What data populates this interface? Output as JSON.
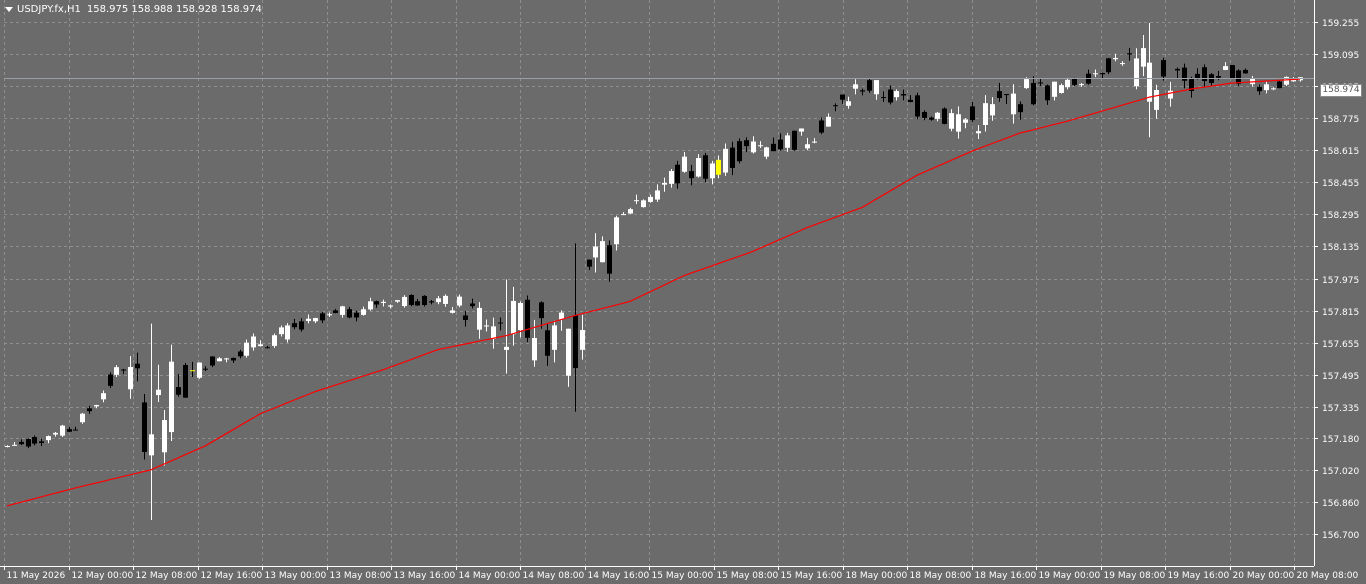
{
  "header": {
    "symbol_label": "USDJPY.fx,H1",
    "ohlc": "158.975 158.988 158.928 158.974"
  },
  "current_price_label": "158.974",
  "colors": {
    "background": "#6b6b6b",
    "grid": "#8f8f8f",
    "text": "#ffffff",
    "bull_candle": "#ffffff",
    "bear_candle": "#000000",
    "highlight_candle": "#ffff00",
    "moving_average": "#ff0000",
    "bid_line": "#9aa0a6"
  },
  "chart_data": {
    "type": "candlestick",
    "ylim": [
      156.7,
      159.33
    ],
    "y_ticks": [
      "159.255",
      "159.095",
      "158.935",
      "158.775",
      "158.615",
      "158.455",
      "158.295",
      "158.135",
      "157.975",
      "157.815",
      "157.655",
      "157.495",
      "157.335",
      "157.180",
      "157.020",
      "156.860",
      "156.700"
    ],
    "x_ticks": [
      "11 May 2026",
      "12 May 00:00",
      "12 May 08:00",
      "12 May 16:00",
      "13 May 00:00",
      "13 May 08:00",
      "13 May 16:00",
      "14 May 00:00",
      "14 May 08:00",
      "14 May 16:00",
      "15 May 00:00",
      "15 May 08:00",
      "15 May 16:00",
      "18 May 00:00",
      "18 May 08:00",
      "18 May 16:00",
      "19 May 00:00",
      "19 May 08:00",
      "19 May 16:00",
      "20 May 00:00",
      "20 May 08:00"
    ],
    "current_price": 158.974,
    "grid": true,
    "candle_anchors": [
      {
        "bar": 0,
        "low": 157.08,
        "high": 157.19
      },
      {
        "bar": 10,
        "low": 157.18,
        "high": 157.28
      },
      {
        "bar": 17,
        "low": 157.46,
        "high": 157.63
      },
      {
        "bar": 21,
        "low": 156.77,
        "high": 157.75
      },
      {
        "bar": 29,
        "low": 157.5,
        "high": 157.6
      },
      {
        "bar": 37,
        "low": 157.58,
        "high": 157.74
      },
      {
        "bar": 45,
        "low": 157.68,
        "high": 157.82
      },
      {
        "bar": 55,
        "low": 157.8,
        "high": 157.93
      },
      {
        "bar": 63,
        "low": 157.83,
        "high": 157.91
      },
      {
        "bar": 73,
        "low": 157.5,
        "high": 157.97
      },
      {
        "bar": 83,
        "low": 157.31,
        "high": 158.15
      },
      {
        "bar": 91,
        "low": 158.25,
        "high": 158.43
      },
      {
        "bar": 99,
        "low": 158.36,
        "high": 158.67
      },
      {
        "bar": 109,
        "low": 158.51,
        "high": 158.73
      },
      {
        "bar": 117,
        "low": 158.58,
        "high": 158.79
      },
      {
        "bar": 125,
        "low": 158.85,
        "high": 159.04
      },
      {
        "bar": 133,
        "low": 158.73,
        "high": 158.93
      },
      {
        "bar": 141,
        "low": 158.61,
        "high": 158.91
      },
      {
        "bar": 148,
        "low": 158.73,
        "high": 159.05
      },
      {
        "bar": 155,
        "low": 158.87,
        "high": 159.0
      },
      {
        "bar": 163,
        "low": 159.0,
        "high": 159.16
      },
      {
        "bar": 167,
        "low": 158.68,
        "high": 159.25
      },
      {
        "bar": 173,
        "low": 158.83,
        "high": 159.09
      },
      {
        "bar": 179,
        "low": 158.93,
        "high": 159.07
      },
      {
        "bar": 184,
        "low": 158.86,
        "high": 159.02
      },
      {
        "bar": 189,
        "low": 158.94,
        "high": 158.99
      }
    ],
    "ma_anchors": [
      {
        "bar": 0,
        "value": 156.84
      },
      {
        "bar": 10,
        "value": 156.93
      },
      {
        "bar": 21,
        "value": 157.02
      },
      {
        "bar": 29,
        "value": 157.14
      },
      {
        "bar": 37,
        "value": 157.3
      },
      {
        "bar": 45,
        "value": 157.41
      },
      {
        "bar": 55,
        "value": 157.52
      },
      {
        "bar": 63,
        "value": 157.62
      },
      {
        "bar": 73,
        "value": 157.69
      },
      {
        "bar": 83,
        "value": 157.79
      },
      {
        "bar": 91,
        "value": 157.86
      },
      {
        "bar": 99,
        "value": 157.99
      },
      {
        "bar": 109,
        "value": 158.11
      },
      {
        "bar": 117,
        "value": 158.23
      },
      {
        "bar": 125,
        "value": 158.33
      },
      {
        "bar": 133,
        "value": 158.49
      },
      {
        "bar": 141,
        "value": 158.61
      },
      {
        "bar": 148,
        "value": 158.7
      },
      {
        "bar": 155,
        "value": 158.76
      },
      {
        "bar": 163,
        "value": 158.84
      },
      {
        "bar": 167,
        "value": 158.88
      },
      {
        "bar": 173,
        "value": 158.92
      },
      {
        "bar": 179,
        "value": 158.95
      },
      {
        "bar": 189,
        "value": 158.97
      }
    ],
    "bar_count": 190
  }
}
